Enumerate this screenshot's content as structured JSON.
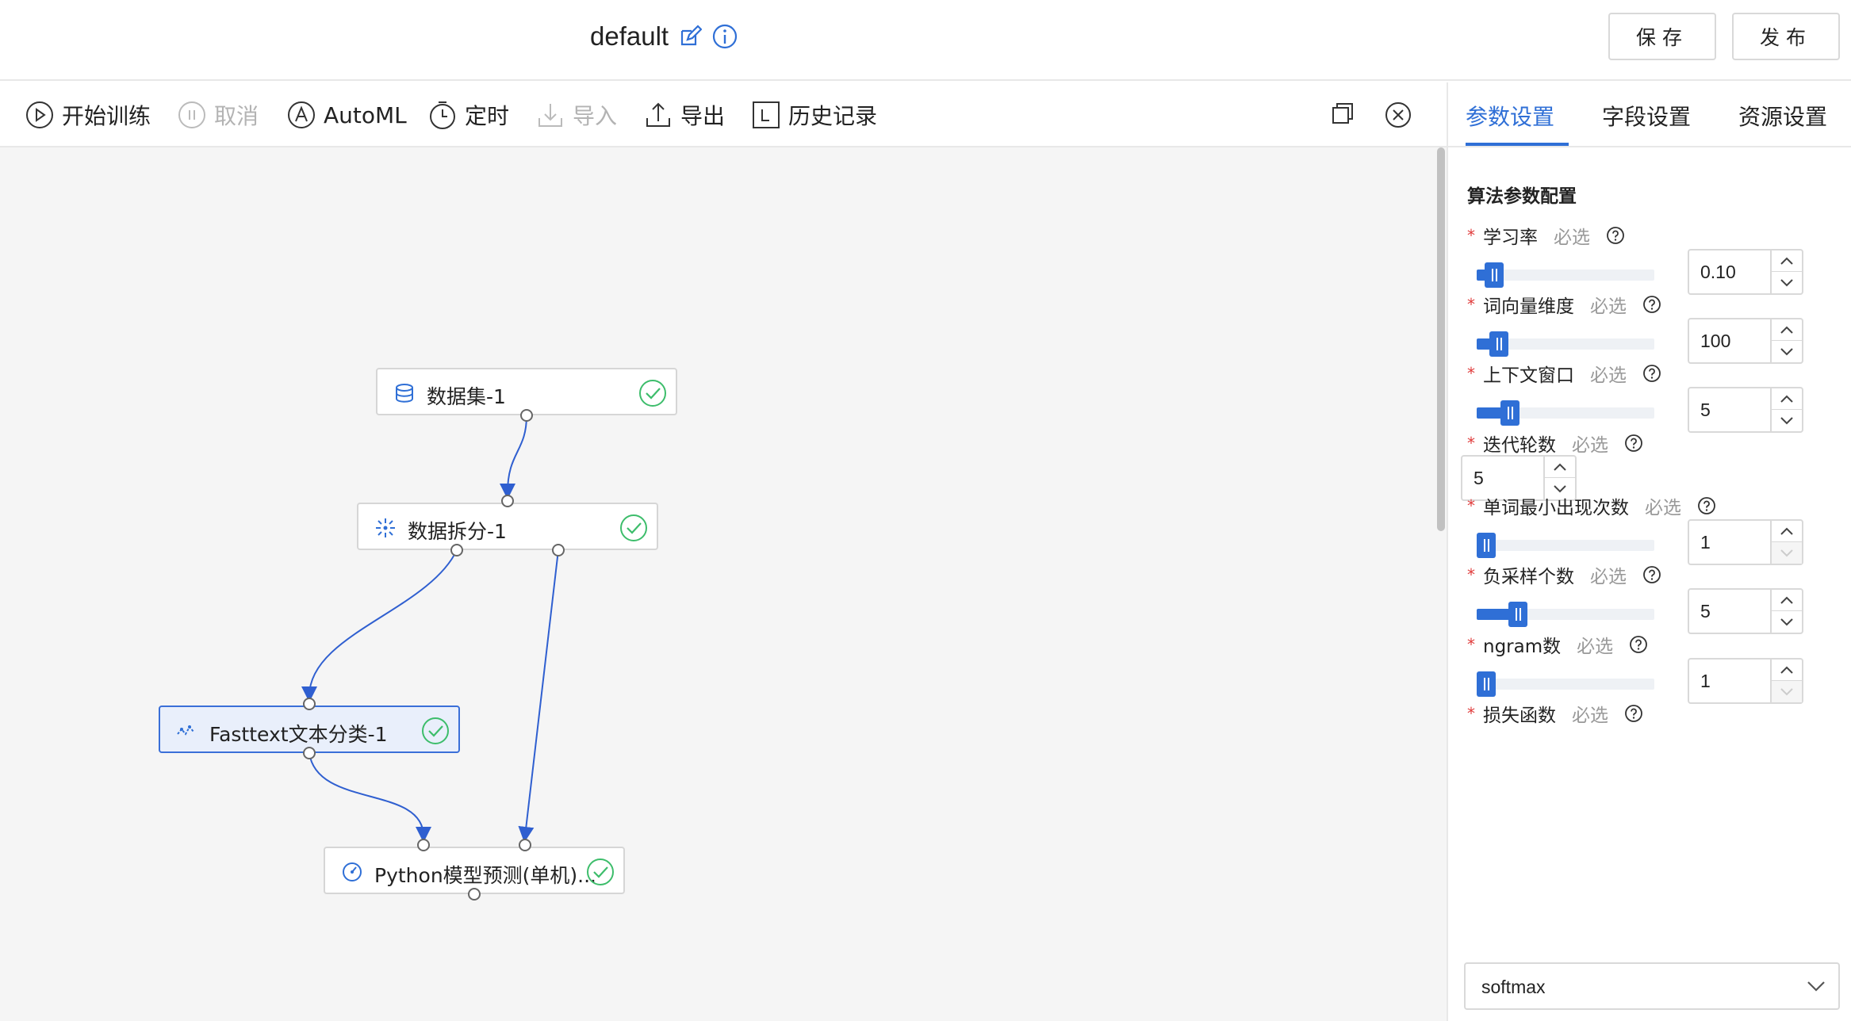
{
  "header": {
    "title": "default",
    "edit_icon": "edit-icon",
    "info_icon": "info-icon",
    "save_label": "保存",
    "publish_label": "发布"
  },
  "toolbar": {
    "items": [
      {
        "label": "开始训练",
        "icon": "play-icon",
        "enabled": true
      },
      {
        "label": "取消",
        "icon": "pause-icon",
        "enabled": false
      },
      {
        "label": "AutoML",
        "icon": "automl-icon",
        "enabled": true
      },
      {
        "label": "定时",
        "icon": "timer-icon",
        "enabled": true
      },
      {
        "label": "导入",
        "icon": "import-icon",
        "enabled": false
      },
      {
        "label": "导出",
        "icon": "export-icon",
        "enabled": true
      },
      {
        "label": "历史记录",
        "icon": "history-icon",
        "enabled": true
      }
    ],
    "right_icons": [
      "window-icon",
      "close-icon"
    ]
  },
  "canvas": {
    "nodes": [
      {
        "label": "数据集-1",
        "icon": "database-icon",
        "status": "success"
      },
      {
        "label": "数据拆分-1",
        "icon": "split-icon",
        "status": "success"
      },
      {
        "label": "Fasttext文本分类-1",
        "icon": "algorithm-icon",
        "status": "success",
        "selected": true
      },
      {
        "label": "Python模型预测(单机)...",
        "icon": "predict-icon",
        "status": "success"
      }
    ]
  },
  "panel": {
    "tabs": [
      {
        "label": "参数设置",
        "active": true
      },
      {
        "label": "字段设置",
        "active": false
      },
      {
        "label": "资源设置",
        "active": false
      }
    ],
    "section_title": "算法参数配置",
    "required_mark": "*",
    "optional_text": "必选",
    "fields": [
      {
        "label": "学习率",
        "value": "0.10",
        "slider_fraction": 0.05
      },
      {
        "label": "词向量维度",
        "value": "100",
        "slider_fraction": 0.08
      },
      {
        "label": "上下文窗口",
        "value": "5",
        "slider_fraction": 0.15
      },
      {
        "label": "迭代轮数",
        "value": "5"
      },
      {
        "label": "单词最小出现次数",
        "value": "1",
        "slider_fraction": 0.0
      },
      {
        "label": "负采样个数",
        "value": "5",
        "slider_fraction": 0.2
      },
      {
        "label": "ngram数",
        "value": "1",
        "slider_fraction": 0.0
      },
      {
        "label": "损失函数",
        "value": "softmax"
      }
    ]
  },
  "colors": {
    "accent": "#2f6fd6",
    "success": "#3dbd6b",
    "required": "#e03b3b",
    "canvas_bg": "#f5f5f5"
  }
}
